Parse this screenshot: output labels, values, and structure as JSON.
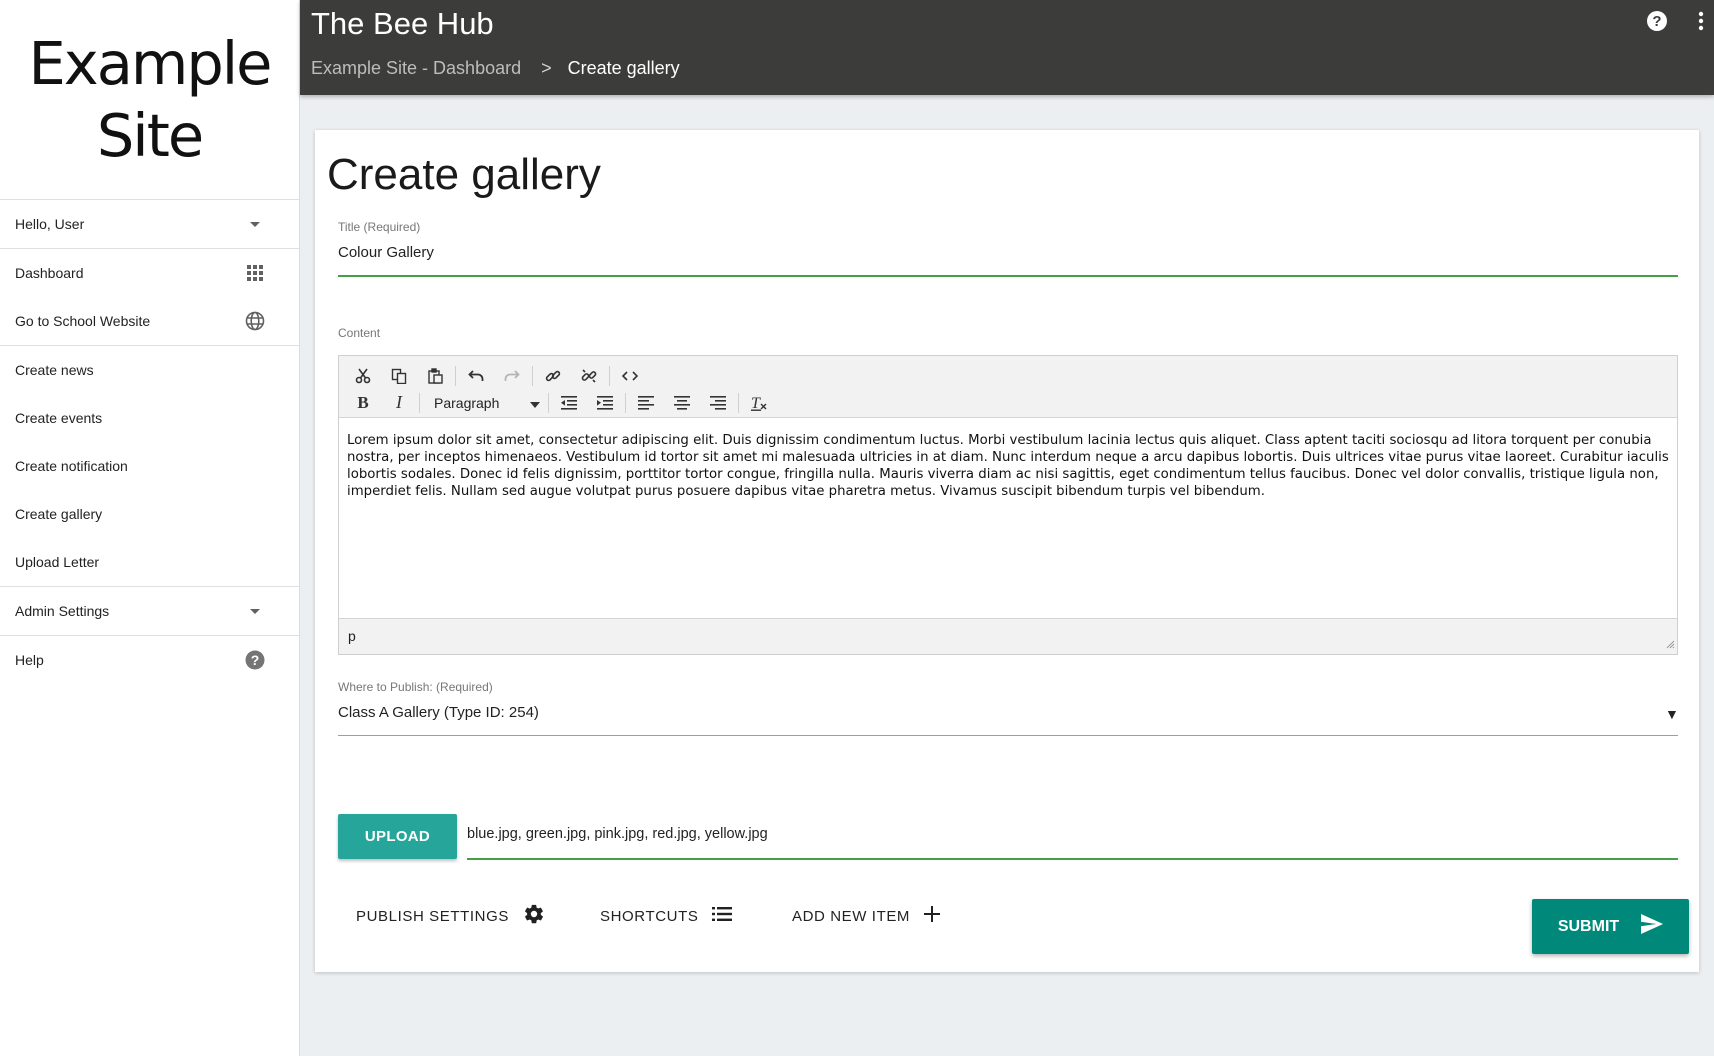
{
  "sidebar": {
    "logo_line1": "Example",
    "logo_line2": "Site",
    "user_menu": {
      "label": "Hello, User",
      "icon": "chevron-down-icon"
    },
    "nav_primary": [
      {
        "label": "Dashboard",
        "icon": "apps-grid-icon"
      },
      {
        "label": "Go to School Website",
        "icon": "globe-icon"
      }
    ],
    "nav_create": [
      {
        "label": "Create news"
      },
      {
        "label": "Create events"
      },
      {
        "label": "Create notification"
      },
      {
        "label": "Create gallery"
      },
      {
        "label": "Upload Letter"
      }
    ],
    "admin_menu": {
      "label": "Admin Settings",
      "icon": "chevron-down-icon"
    },
    "help": {
      "label": "Help",
      "icon": "help-icon"
    }
  },
  "header": {
    "app_title": "The Bee Hub",
    "breadcrumb": {
      "parent": "Example Site - Dashboard",
      "separator": ">",
      "current": "Create gallery"
    },
    "icons": [
      "help-icon",
      "more-vert-icon"
    ]
  },
  "form": {
    "page_title": "Create gallery",
    "title_field": {
      "label": "Title (Required)",
      "value": "Colour Gallery"
    },
    "content_field": {
      "label": "Content",
      "format_select": "Paragraph",
      "body": "Lorem ipsum dolor sit amet, consectetur adipiscing elit. Duis dignissim condimentum luctus. Morbi vestibulum lacinia lectus quis aliquet. Class aptent taciti sociosqu ad litora torquent per conubia nostra, per inceptos himenaeos. Vestibulum id tortor sit amet mi malesuada ultricies in at diam. Nunc interdum neque a arcu dapibus lobortis. Duis ultrices vitae purus vitae laoreet. Curabitur iaculis lobortis sodales. Donec id felis dignissim, porttitor tortor congue, fringilla nulla. Mauris viverra diam ac nisi sagittis, eget condimentum tellus faucibus. Donec vel dolor convallis, tristique ligula non, imperdiet felis. Nullam sed augue volutpat purus posuere dapibus vitae pharetra metus. Vivamus suscipit bibendum turpis vel bibendum.",
      "status_path": "p"
    },
    "publish_field": {
      "label": "Where to Publish: (Required)",
      "value": "Class A Gallery (Type ID: 254)",
      "arrow": "▼"
    },
    "upload": {
      "button_label": "UPLOAD",
      "files": "blue.jpg, green.jpg, pink.jpg, red.jpg, yellow.jpg"
    },
    "actions": {
      "publish_settings": "PUBLISH SETTINGS",
      "shortcuts": "SHORTCUTS",
      "add_new_item": "ADD NEW ITEM",
      "submit": "SUBMIT"
    }
  },
  "colors": {
    "topbar": "#3c3c3a",
    "valid_underline": "#43a047",
    "neutral_underline": "#9e9e9e",
    "upload_button": "#26a69a",
    "submit_button": "#00897b",
    "background": "#eceff1"
  }
}
